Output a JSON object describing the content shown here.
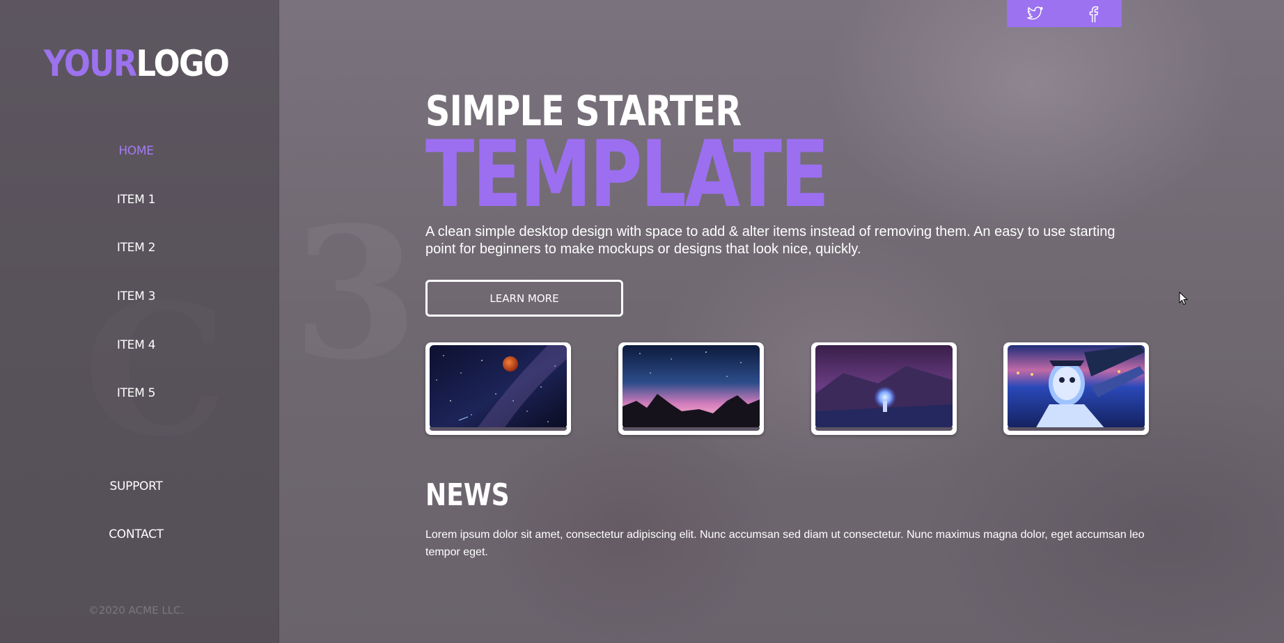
{
  "colors": {
    "accent": "#9c72f0",
    "sidebar": "#4a4450",
    "text": "#ffffff"
  },
  "logo": {
    "part1": "YOUR",
    "part2": "LOGO"
  },
  "nav": {
    "items": [
      {
        "label": "HOME",
        "active": true
      },
      {
        "label": "ITEM 1"
      },
      {
        "label": "ITEM 2"
      },
      {
        "label": "ITEM 3"
      },
      {
        "label": "ITEM 4"
      },
      {
        "label": "ITEM 5"
      }
    ],
    "support": "SUPPORT",
    "contact": "CONTACT",
    "copyright": "©2020 ACME LLC."
  },
  "social": {
    "icons": [
      "twitter-icon",
      "facebook-icon"
    ]
  },
  "hero": {
    "title_line1": "SIMPLE STARTER",
    "title_line2": "TEMPLATE",
    "description": "A clean simple desktop design with space to add & alter items instead of removing them. An easy to use starting point for beginners to make mockups or designs that look nice, quickly.",
    "button_label": "LEARN MORE"
  },
  "gallery": {
    "items": [
      "blood-moon-milky-way",
      "pink-night-sky-mountains",
      "astronaut-glowing-orb",
      "masked-character-neon"
    ]
  },
  "news": {
    "title": "NEWS",
    "text": "Lorem ipsum dolor sit amet, consectetur adipiscing elit. Nunc accumsan sed diam ut consectetur. Nunc maximus magna dolor, eget accumsan leo tempor eget."
  }
}
